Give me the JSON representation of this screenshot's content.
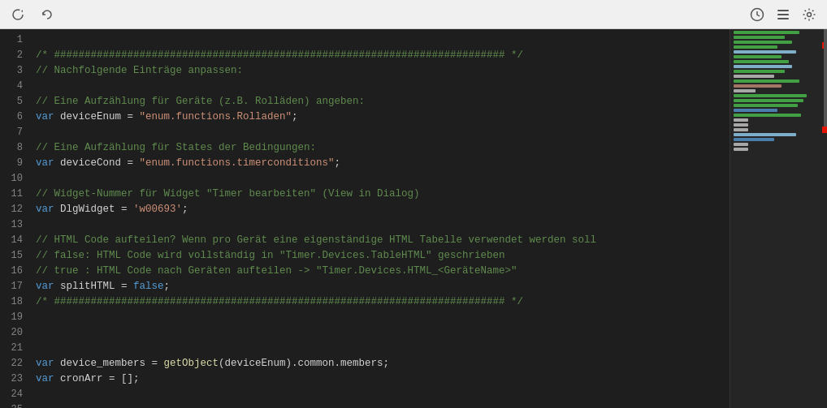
{
  "toolbar": {
    "reload_label": "⟳",
    "history_label": "🕐",
    "list_label": "☰",
    "settings_label": "🔧"
  },
  "editor": {
    "lines": [
      {
        "num": 1,
        "content": []
      },
      {
        "num": 2,
        "content": [
          {
            "type": "comment",
            "text": "/* ########################################################################## */"
          }
        ]
      },
      {
        "num": 3,
        "content": [
          {
            "type": "comment",
            "text": "// Nachfolgende Einträge anpassen:"
          }
        ]
      },
      {
        "num": 4,
        "content": []
      },
      {
        "num": 5,
        "content": [
          {
            "type": "comment",
            "text": "// Eine Aufzählung für Geräte (z.B. Rolläden) angeben:"
          }
        ]
      },
      {
        "num": 6,
        "content": [
          {
            "type": "keyword",
            "text": "var"
          },
          {
            "type": "plain",
            "text": " deviceEnum = "
          },
          {
            "type": "string",
            "text": "\"enum.functions.Rolladen\""
          },
          {
            "type": "plain",
            "text": ";"
          }
        ]
      },
      {
        "num": 7,
        "content": []
      },
      {
        "num": 8,
        "content": [
          {
            "type": "comment",
            "text": "// Eine Aufzählung für States der Bedingungen:"
          }
        ]
      },
      {
        "num": 9,
        "content": [
          {
            "type": "keyword",
            "text": "var"
          },
          {
            "type": "plain",
            "text": " deviceCond = "
          },
          {
            "type": "string",
            "text": "\"enum.functions.timerconditions\""
          },
          {
            "type": "plain",
            "text": ";"
          }
        ]
      },
      {
        "num": 10,
        "content": []
      },
      {
        "num": 11,
        "content": [
          {
            "type": "comment",
            "text": "// Widget-Nummer für Widget \"Timer bearbeiten\" (View in Dialog)"
          }
        ]
      },
      {
        "num": 12,
        "content": [
          {
            "type": "keyword",
            "text": "var"
          },
          {
            "type": "plain",
            "text": " DlgWidget = "
          },
          {
            "type": "string",
            "text": "'w00693'"
          },
          {
            "type": "plain",
            "text": ";"
          }
        ]
      },
      {
        "num": 13,
        "content": []
      },
      {
        "num": 14,
        "content": [
          {
            "type": "comment",
            "text": "// HTML Code aufteilen? Wenn pro Gerät eine eigenständige HTML Tabelle verwendet werden soll"
          }
        ]
      },
      {
        "num": 15,
        "content": [
          {
            "type": "comment",
            "text": "// false: HTML Code wird vollständig in \"Timer.Devices.TableHTML\" geschrieben"
          }
        ]
      },
      {
        "num": 16,
        "content": [
          {
            "type": "comment",
            "text": "// true : HTML Code nach Geräten aufteilen -> \"Timer.Devices.HTML_<GeräteName>\""
          }
        ]
      },
      {
        "num": 17,
        "content": [
          {
            "type": "keyword",
            "text": "var"
          },
          {
            "type": "plain",
            "text": " splitHTML = "
          },
          {
            "type": "keyword",
            "text": "false"
          },
          {
            "type": "plain",
            "text": ";"
          }
        ]
      },
      {
        "num": 18,
        "content": [
          {
            "type": "comment",
            "text": "/* ########################################################################## */"
          }
        ]
      },
      {
        "num": 19,
        "content": []
      },
      {
        "num": 20,
        "content": []
      },
      {
        "num": 21,
        "content": []
      },
      {
        "num": 22,
        "content": [
          {
            "type": "keyword",
            "text": "var"
          },
          {
            "type": "plain",
            "text": " device_members = "
          },
          {
            "type": "function",
            "text": "getObject"
          },
          {
            "type": "plain",
            "text": "(deviceEnum).common.members;"
          }
        ]
      },
      {
        "num": 23,
        "content": [
          {
            "type": "keyword",
            "text": "var"
          },
          {
            "type": "plain",
            "text": " cronArr = [];"
          }
        ]
      },
      {
        "num": 24,
        "content": []
      },
      {
        "num": 25,
        "content": []
      }
    ]
  },
  "minimap": {
    "lines": [
      {
        "color": "#4ec94e",
        "width": 90
      },
      {
        "color": "#4ec94e",
        "width": 70
      },
      {
        "color": "#4ec94e",
        "width": 80
      },
      {
        "color": "#4ec94e",
        "width": 60
      },
      {
        "color": "#9cdcfe",
        "width": 85
      },
      {
        "color": "#4ec94e",
        "width": 65
      },
      {
        "color": "#4ec94e",
        "width": 75
      },
      {
        "color": "#9cdcfe",
        "width": 80
      },
      {
        "color": "#4ec94e",
        "width": 70
      },
      {
        "color": "#d4d4d4",
        "width": 55
      },
      {
        "color": "#4ec94e",
        "width": 90
      },
      {
        "color": "#ce9178",
        "width": 65
      },
      {
        "color": "#d4d4d4",
        "width": 30
      },
      {
        "color": "#4ec94e",
        "width": 100
      },
      {
        "color": "#4ec94e",
        "width": 95
      },
      {
        "color": "#4ec94e",
        "width": 88
      },
      {
        "color": "#569cd6",
        "width": 60
      },
      {
        "color": "#4ec94e",
        "width": 92
      },
      {
        "color": "#d4d4d4",
        "width": 20
      },
      {
        "color": "#d4d4d4",
        "width": 20
      },
      {
        "color": "#d4d4d4",
        "width": 20
      },
      {
        "color": "#9cdcfe",
        "width": 85
      },
      {
        "color": "#569cd6",
        "width": 55
      },
      {
        "color": "#d4d4d4",
        "width": 20
      },
      {
        "color": "#d4d4d4",
        "width": 20
      }
    ]
  }
}
